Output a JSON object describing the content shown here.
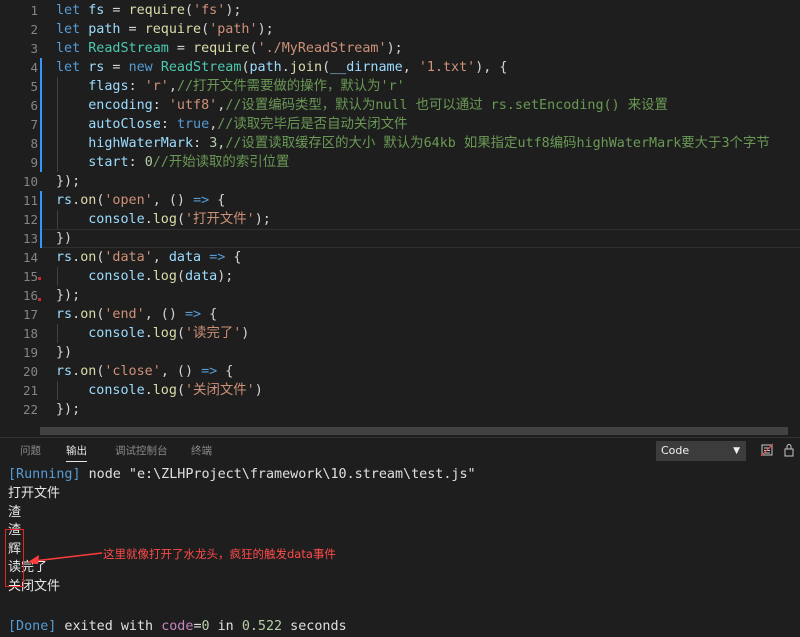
{
  "editor": {
    "lines": [
      {
        "n": "1",
        "tokens": [
          [
            "k",
            "let "
          ],
          [
            "p",
            "fs"
          ],
          [
            "w",
            " = "
          ],
          [
            "f",
            "require"
          ],
          [
            "w",
            "("
          ],
          [
            "s",
            "'fs'"
          ],
          [
            "w",
            ");"
          ]
        ]
      },
      {
        "n": "2",
        "tokens": [
          [
            "k",
            "let "
          ],
          [
            "p",
            "path"
          ],
          [
            "w",
            " = "
          ],
          [
            "f",
            "require"
          ],
          [
            "w",
            "("
          ],
          [
            "s",
            "'path'"
          ],
          [
            "w",
            ");"
          ]
        ]
      },
      {
        "n": "3",
        "tokens": [
          [
            "k",
            "let "
          ],
          [
            "t",
            "ReadStream"
          ],
          [
            "w",
            " = "
          ],
          [
            "f",
            "require"
          ],
          [
            "w",
            "("
          ],
          [
            "s",
            "'./MyReadStream'"
          ],
          [
            "w",
            ");"
          ]
        ]
      },
      {
        "n": "4",
        "tokens": [
          [
            "k",
            "let "
          ],
          [
            "p",
            "rs"
          ],
          [
            "w",
            " = "
          ],
          [
            "k",
            "new "
          ],
          [
            "t",
            "ReadStream"
          ],
          [
            "w",
            "("
          ],
          [
            "p",
            "path"
          ],
          [
            "w",
            "."
          ],
          [
            "f",
            "join"
          ],
          [
            "w",
            "("
          ],
          [
            "p",
            "__dirname"
          ],
          [
            "w",
            ", "
          ],
          [
            "s",
            "'1.txt'"
          ],
          [
            "w",
            "), {"
          ]
        ]
      },
      {
        "n": "5",
        "tokens": [
          [
            "w",
            "    "
          ],
          [
            "p",
            "flags"
          ],
          [
            "w",
            ": "
          ],
          [
            "s",
            "'r'"
          ],
          [
            "w",
            ","
          ],
          [
            "c",
            "//打开文件需要做的操作，默认为'r'"
          ]
        ]
      },
      {
        "n": "6",
        "tokens": [
          [
            "w",
            "    "
          ],
          [
            "p",
            "encoding"
          ],
          [
            "w",
            ": "
          ],
          [
            "s",
            "'utf8'"
          ],
          [
            "w",
            ","
          ],
          [
            "c",
            "//设置编码类型，默认为null 也可以通过 rs.setEncoding() 来设置"
          ]
        ]
      },
      {
        "n": "7",
        "tokens": [
          [
            "w",
            "    "
          ],
          [
            "p",
            "autoClose"
          ],
          [
            "w",
            ": "
          ],
          [
            "k",
            "true"
          ],
          [
            "w",
            ","
          ],
          [
            "c",
            "//读取完毕后是否自动关闭文件"
          ]
        ]
      },
      {
        "n": "8",
        "tokens": [
          [
            "w",
            "    "
          ],
          [
            "p",
            "highWaterMark"
          ],
          [
            "w",
            ": "
          ],
          [
            "n",
            "3"
          ],
          [
            "w",
            ","
          ],
          [
            "c",
            "//设置读取缓存区的大小 默认为64kb 如果指定utf8编码highWaterMark要大于3个字节"
          ]
        ]
      },
      {
        "n": "9",
        "tokens": [
          [
            "w",
            "    "
          ],
          [
            "p",
            "start"
          ],
          [
            "w",
            ": "
          ],
          [
            "n",
            "0"
          ],
          [
            "c",
            "//开始读取的索引位置"
          ]
        ]
      },
      {
        "n": "10",
        "tokens": [
          [
            "w",
            "});"
          ]
        ]
      },
      {
        "n": "11",
        "tokens": [
          [
            "p",
            "rs"
          ],
          [
            "w",
            "."
          ],
          [
            "f",
            "on"
          ],
          [
            "w",
            "("
          ],
          [
            "s",
            "'open'"
          ],
          [
            "w",
            ", () "
          ],
          [
            "k",
            "=>"
          ],
          [
            "w",
            " {"
          ]
        ]
      },
      {
        "n": "12",
        "tokens": [
          [
            "w",
            "    "
          ],
          [
            "p",
            "console"
          ],
          [
            "w",
            "."
          ],
          [
            "f",
            "log"
          ],
          [
            "w",
            "("
          ],
          [
            "s",
            "'打开文件'"
          ],
          [
            "w",
            ");"
          ]
        ]
      },
      {
        "n": "13",
        "tokens": [
          [
            "w",
            "})"
          ]
        ]
      },
      {
        "n": "14",
        "tokens": [
          [
            "p",
            "rs"
          ],
          [
            "w",
            "."
          ],
          [
            "f",
            "on"
          ],
          [
            "w",
            "("
          ],
          [
            "s",
            "'data'"
          ],
          [
            "w",
            ", "
          ],
          [
            "p",
            "data"
          ],
          [
            "w",
            " "
          ],
          [
            "k",
            "=>"
          ],
          [
            "w",
            " {"
          ]
        ]
      },
      {
        "n": "15",
        "tokens": [
          [
            "w",
            "    "
          ],
          [
            "p",
            "console"
          ],
          [
            "w",
            "."
          ],
          [
            "f",
            "log"
          ],
          [
            "w",
            "("
          ],
          [
            "p",
            "data"
          ],
          [
            "w",
            ");"
          ]
        ]
      },
      {
        "n": "16",
        "tokens": [
          [
            "w",
            "});"
          ]
        ]
      },
      {
        "n": "17",
        "tokens": [
          [
            "p",
            "rs"
          ],
          [
            "w",
            "."
          ],
          [
            "f",
            "on"
          ],
          [
            "w",
            "("
          ],
          [
            "s",
            "'end'"
          ],
          [
            "w",
            ", () "
          ],
          [
            "k",
            "=>"
          ],
          [
            "w",
            " {"
          ]
        ]
      },
      {
        "n": "18",
        "tokens": [
          [
            "w",
            "    "
          ],
          [
            "p",
            "console"
          ],
          [
            "w",
            "."
          ],
          [
            "f",
            "log"
          ],
          [
            "w",
            "("
          ],
          [
            "s",
            "'读完了'"
          ],
          [
            "w",
            ")"
          ]
        ]
      },
      {
        "n": "19",
        "tokens": [
          [
            "w",
            "})"
          ]
        ]
      },
      {
        "n": "20",
        "tokens": [
          [
            "p",
            "rs"
          ],
          [
            "w",
            "."
          ],
          [
            "f",
            "on"
          ],
          [
            "w",
            "("
          ],
          [
            "s",
            "'close'"
          ],
          [
            "w",
            ", () "
          ],
          [
            "k",
            "=>"
          ],
          [
            "w",
            " {"
          ]
        ]
      },
      {
        "n": "21",
        "tokens": [
          [
            "w",
            "    "
          ],
          [
            "p",
            "console"
          ],
          [
            "w",
            "."
          ],
          [
            "f",
            "log"
          ],
          [
            "w",
            "("
          ],
          [
            "s",
            "'关闭文件'"
          ],
          [
            "w",
            ")"
          ]
        ]
      },
      {
        "n": "22",
        "tokens": [
          [
            "w",
            "});"
          ]
        ]
      }
    ]
  },
  "panel": {
    "tabs": [
      "问题",
      "输出",
      "调试控制台",
      "终端"
    ],
    "active_tab": 1,
    "output_channel": "Code",
    "icons": [
      "clear-output-icon",
      "lock-scroll-icon"
    ]
  },
  "output": {
    "running_tag": "[Running]",
    "command": " node \"e:\\ZLHProject\\framework\\10.stream\\test.js\"",
    "lines": [
      "打开文件",
      "渣",
      "渣",
      "辉",
      "读完了",
      "关闭文件"
    ],
    "done_tag": "[Done]",
    "done_text_1": " exited with ",
    "done_code_key": "code",
    "done_eq": "=",
    "done_code_val": "0",
    "done_text_2": " in ",
    "done_time": "0.522",
    "done_text_3": " seconds"
  },
  "annotation": {
    "text": "这里就像打开了水龙头，疯狂的触发data事件",
    "color": "#ff4a4a"
  }
}
